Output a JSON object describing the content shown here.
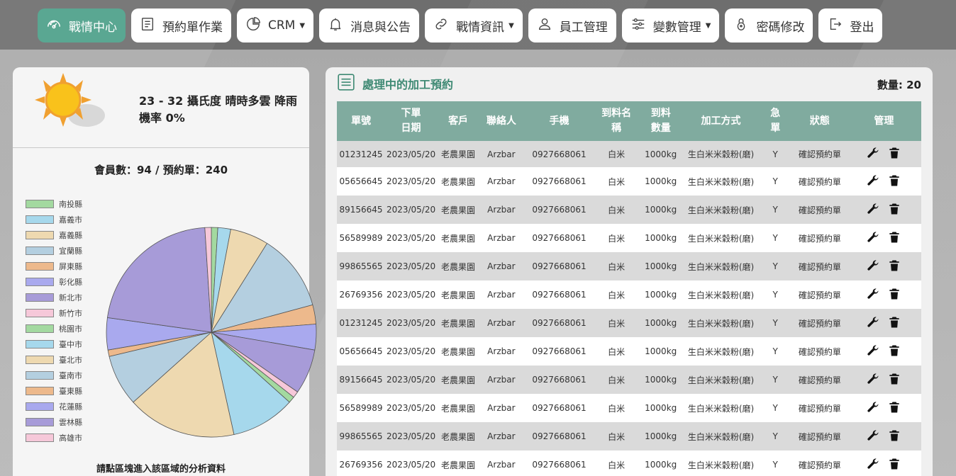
{
  "nav": {
    "items": [
      {
        "label": "戰情中心",
        "icon": "dashboard-icon",
        "active": true
      },
      {
        "label": "預約單作業",
        "icon": "document-icon"
      },
      {
        "label": "CRM",
        "icon": "pie-chart-icon",
        "dropdown": true
      },
      {
        "label": "消息與公告",
        "icon": "bell-icon"
      },
      {
        "label": "戰情資訊",
        "icon": "link-icon",
        "dropdown": true
      },
      {
        "label": "員工管理",
        "icon": "user-icon"
      },
      {
        "label": "變數管理",
        "icon": "sliders-icon",
        "dropdown": true
      },
      {
        "label": "密碼修改",
        "icon": "lock-icon"
      },
      {
        "label": "登出",
        "icon": "logout-icon"
      }
    ]
  },
  "weather": {
    "icon": "sun-cloud-icon",
    "text": "23 - 32 攝氏度 晴時多雲 降雨機率 0%"
  },
  "stats": {
    "text": "會員數：94 / 預約單：240"
  },
  "hint": "請點區塊進入該區域的分析資料",
  "chart_data": {
    "type": "pie",
    "categories": [
      "南投縣",
      "嘉義市",
      "嘉義縣",
      "宜蘭縣",
      "屏東縣",
      "彰化縣",
      "新北市",
      "新竹市",
      "桃園市",
      "臺中市",
      "臺北市",
      "臺南市",
      "臺東縣",
      "花蓮縣",
      "雲林縣",
      "高雄市"
    ],
    "values": [
      1,
      2,
      6,
      12,
      3,
      4,
      7,
      1,
      1,
      10,
      17,
      8,
      1,
      5,
      22,
      1
    ],
    "colors": [
      "#a3d9a0",
      "#a6d8ec",
      "#eed9b0",
      "#b4cfe0",
      "#edb98c",
      "#a9a9ee",
      "#a79bd8",
      "#f6c8d9",
      "#a3d9a0",
      "#a6d8ec",
      "#eed9b0",
      "#b4cfe0",
      "#edb98c",
      "#a9a9ee",
      "#a79bd8",
      "#f6c8d9"
    ],
    "legend_position": "left"
  },
  "orders": {
    "title": "處理中的加工預約",
    "count_label": "數量: 20",
    "headers": [
      "單號",
      "下單\n日期",
      "客戶",
      "聯絡人",
      "手機",
      "到料名\n稱",
      "到料\n數量",
      "加工方式",
      "急\n單",
      "狀態",
      "管理"
    ],
    "rows": [
      [
        "01231245",
        "2023/05/20",
        "老農果園",
        "Arzbar",
        "0927668061",
        "白米",
        "1000kg",
        "生白米米穀粉(磨)",
        "Y",
        "確認預約單"
      ],
      [
        "05656645",
        "2023/05/20",
        "老農果園",
        "Arzbar",
        "0927668061",
        "白米",
        "1000kg",
        "生白米米穀粉(磨)",
        "Y",
        "確認預約單"
      ],
      [
        "89156645",
        "2023/05/20",
        "老農果園",
        "Arzbar",
        "0927668061",
        "白米",
        "1000kg",
        "生白米米穀粉(磨)",
        "Y",
        "確認預約單"
      ],
      [
        "56589989",
        "2023/05/20",
        "老農果園",
        "Arzbar",
        "0927668061",
        "白米",
        "1000kg",
        "生白米米穀粉(磨)",
        "Y",
        "確認預約單"
      ],
      [
        "99865565",
        "2023/05/20",
        "老農果園",
        "Arzbar",
        "0927668061",
        "白米",
        "1000kg",
        "生白米米穀粉(磨)",
        "Y",
        "確認預約單"
      ],
      [
        "26769356",
        "2023/05/20",
        "老農果園",
        "Arzbar",
        "0927668061",
        "白米",
        "1000kg",
        "生白米米穀粉(磨)",
        "Y",
        "確認預約單"
      ],
      [
        "01231245",
        "2023/05/20",
        "老農果園",
        "Arzbar",
        "0927668061",
        "白米",
        "1000kg",
        "生白米米穀粉(磨)",
        "Y",
        "確認預約單"
      ],
      [
        "05656645",
        "2023/05/20",
        "老農果園",
        "Arzbar",
        "0927668061",
        "白米",
        "1000kg",
        "生白米米穀粉(磨)",
        "Y",
        "確認預約單"
      ],
      [
        "89156645",
        "2023/05/20",
        "老農果園",
        "Arzbar",
        "0927668061",
        "白米",
        "1000kg",
        "生白米米穀粉(磨)",
        "Y",
        "確認預約單"
      ],
      [
        "56589989",
        "2023/05/20",
        "老農果園",
        "Arzbar",
        "0927668061",
        "白米",
        "1000kg",
        "生白米米穀粉(磨)",
        "Y",
        "確認預約單"
      ],
      [
        "99865565",
        "2023/05/20",
        "老農果園",
        "Arzbar",
        "0927668061",
        "白米",
        "1000kg",
        "生白米米穀粉(磨)",
        "Y",
        "確認預約單"
      ],
      [
        "26769356",
        "2023/05/20",
        "老農果園",
        "Arzbar",
        "0927668061",
        "白米",
        "1000kg",
        "生白米米穀粉(磨)",
        "Y",
        "確認預約單"
      ]
    ]
  }
}
